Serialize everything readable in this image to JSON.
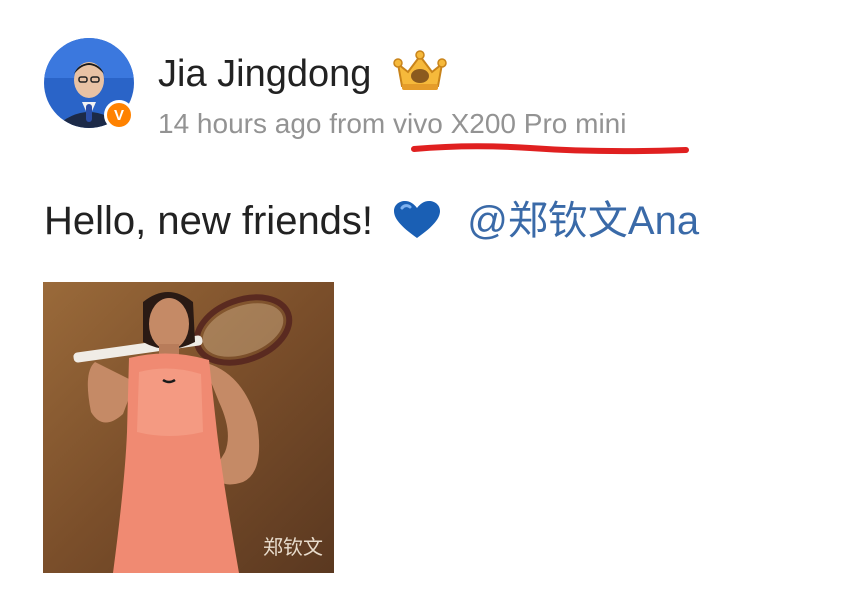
{
  "post": {
    "author": {
      "name": "Jia Jingdong",
      "verified_badge": "V",
      "verified_color": "#ff8200"
    },
    "meta": {
      "time_ago": "14 hours ago",
      "from_word": "from",
      "device": "vivo X200 Pro mini"
    },
    "content": {
      "text": "Hello, new friends!",
      "emoji_icon": "blue-heart-icon",
      "mention": "@郑钦文Ana"
    },
    "image": {
      "signature_text": "郑钦文"
    },
    "colors": {
      "name": "#222222",
      "meta": "#939393",
      "mention": "#3a6aa8",
      "annotation_underline": "#e02020",
      "heart": "#1a5fb4"
    }
  }
}
